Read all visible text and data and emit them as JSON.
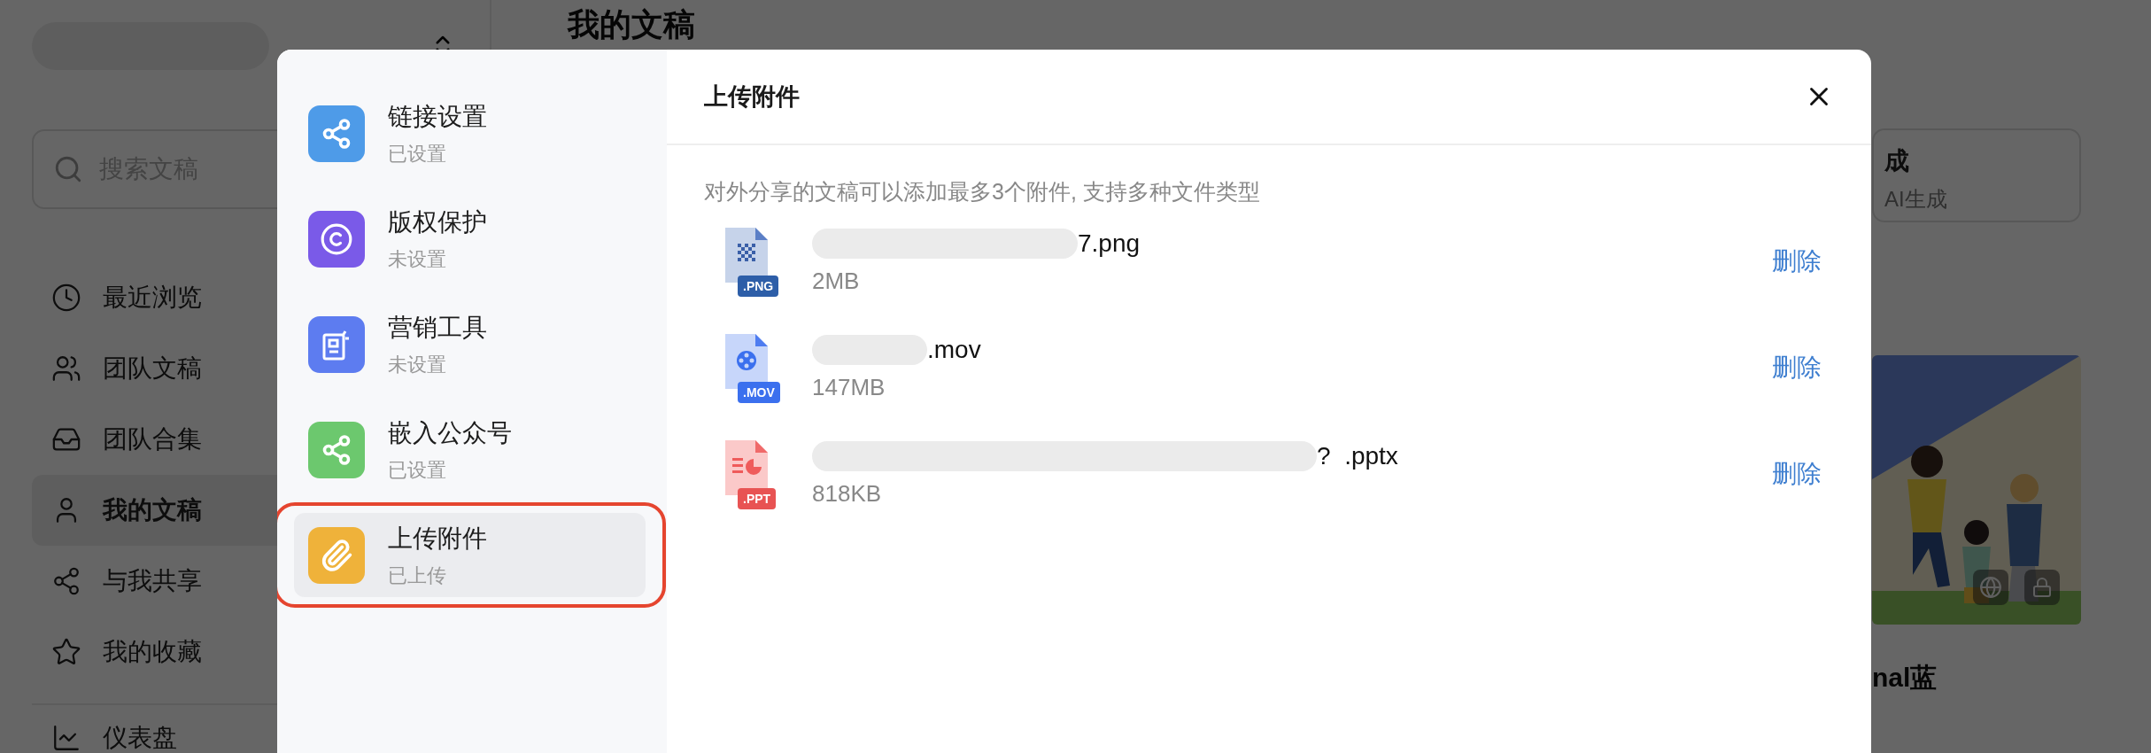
{
  "sidebar": {
    "search": {
      "placeholder": "搜索文稿"
    },
    "nav": [
      {
        "kind": "recent",
        "label": "最近浏览",
        "selected": false
      },
      {
        "kind": "team",
        "label": "团队文稿",
        "selected": false
      },
      {
        "kind": "collection",
        "label": "团队合集",
        "selected": false
      },
      {
        "kind": "mine",
        "label": "我的文稿",
        "selected": true
      },
      {
        "kind": "shared",
        "label": "与我共享",
        "selected": false
      },
      {
        "kind": "favorites",
        "label": "我的收藏",
        "selected": false
      }
    ],
    "footer_nav": [
      {
        "kind": "dashboard",
        "label": "仪表盘",
        "selected": false
      }
    ]
  },
  "main": {
    "title": "我的文稿",
    "ai_card": {
      "title": "成",
      "subtitle": "AI生成"
    },
    "doc_card": {
      "title": "nal蓝"
    }
  },
  "dialog": {
    "menu": [
      {
        "kind": "link",
        "title": "链接设置",
        "status": "已设置",
        "selected": false
      },
      {
        "kind": "copyright",
        "title": "版权保护",
        "status": "未设置",
        "selected": false
      },
      {
        "kind": "marketing",
        "title": "营销工具",
        "status": "未设置",
        "selected": false
      },
      {
        "kind": "embed",
        "title": "嵌入公众号",
        "status": "已设置",
        "selected": false
      },
      {
        "kind": "attachment",
        "title": "上传附件",
        "status": "已上传",
        "selected": true
      }
    ],
    "title": "上传附件",
    "description": "对外分享的文稿可以添加最多3个附件, 支持多种文件类型",
    "files": [
      {
        "kind": "png",
        "badge": ".PNG",
        "name": "7.png",
        "size": "2MB",
        "redacted": true,
        "action": "删除"
      },
      {
        "kind": "mov",
        "badge": ".MOV",
        "name": ".mov",
        "size": "147MB",
        "redacted": true,
        "action": "删除"
      },
      {
        "kind": "ppt",
        "badge": ".PPT",
        "name": "?  .pptx",
        "size": "818KB",
        "redacted": true,
        "action": "删除"
      }
    ]
  }
}
